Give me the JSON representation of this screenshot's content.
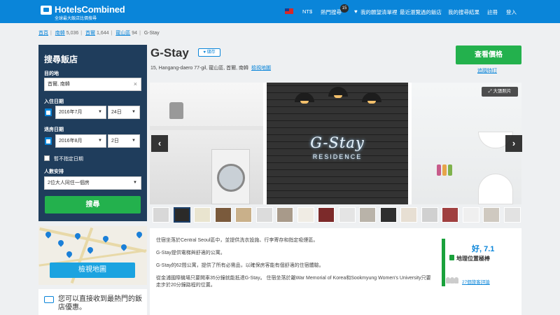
{
  "header": {
    "logo_text": "HotelsCombined",
    "logo_tagline": "全球最大飯店比價搜尋",
    "currency": "NT$",
    "popular_search": "熱門搜尋",
    "popular_badge": "15",
    "favorites": "我的願望清單裡",
    "recent": "最近瀏覽過的飯店",
    "my_results": "我的搜尋結果",
    "register": "註冊",
    "login": "登入"
  },
  "breadcrumb": {
    "items": [
      {
        "label": "首頁",
        "count": ""
      },
      {
        "label": "南韓",
        "count": "5,036"
      },
      {
        "label": "首爾",
        "count": "1,644"
      },
      {
        "label": "龍山區",
        "count": "94"
      }
    ],
    "current": "G-Stay"
  },
  "search": {
    "title": "搜尋飯店",
    "destination_label": "目的地",
    "destination_value": "首爾, 南韓",
    "checkin_label": "入住日期",
    "checkin_month": "2016年7月",
    "checkin_day": "24日",
    "checkout_label": "退房日期",
    "checkout_month": "2016年8月",
    "checkout_day": "2日",
    "no_dates_label": "暫不指定日期",
    "guests_label": "人數安排",
    "guests_value": "2位大人同住一個房",
    "search_button": "搜尋"
  },
  "map": {
    "button": "檢視地圖"
  },
  "promo": {
    "text": "您可以直接收到最熱門的飯店優惠。"
  },
  "hotel": {
    "name": "G-Stay",
    "save_label": "儲存",
    "address": "15, Hangang-daero 77-gil, 龍山區, 首爾, 南韓",
    "view_map": "檢視地圖",
    "price_button": "查看價格",
    "deals_link": "追蹤特訂",
    "big_photo": "大張照片",
    "photo_sign": "G-Stay",
    "photo_sign_sub": "RESIDENCE",
    "thumbnail_count": 18
  },
  "description": {
    "paragraphs": [
      "住宿坐落於Central Seoul區中，並提供洗衣設施、行李寄存和指定吸煙區。",
      "G-Stay提供電梯與舒適的公寓。",
      "G-Stay的62間公寓，提供了所有必需品，以確保房客能有個舒適的住宿體驗。",
      "從金浦國際機場只要開車35分鐘就能抵達G-Stay。 住宿坐落於離War Memorial of Korea和Sookmyung Women's University只要走步於20分鐘路程的位置。"
    ]
  },
  "rating": {
    "label": "好,",
    "score": "7.1",
    "location": "地理位置極棒",
    "reviews": "27個旅客評論"
  },
  "colors": {
    "brand_blue": "#0a85d9",
    "nav_dark": "#1f3d5c",
    "green": "#23b14d"
  }
}
